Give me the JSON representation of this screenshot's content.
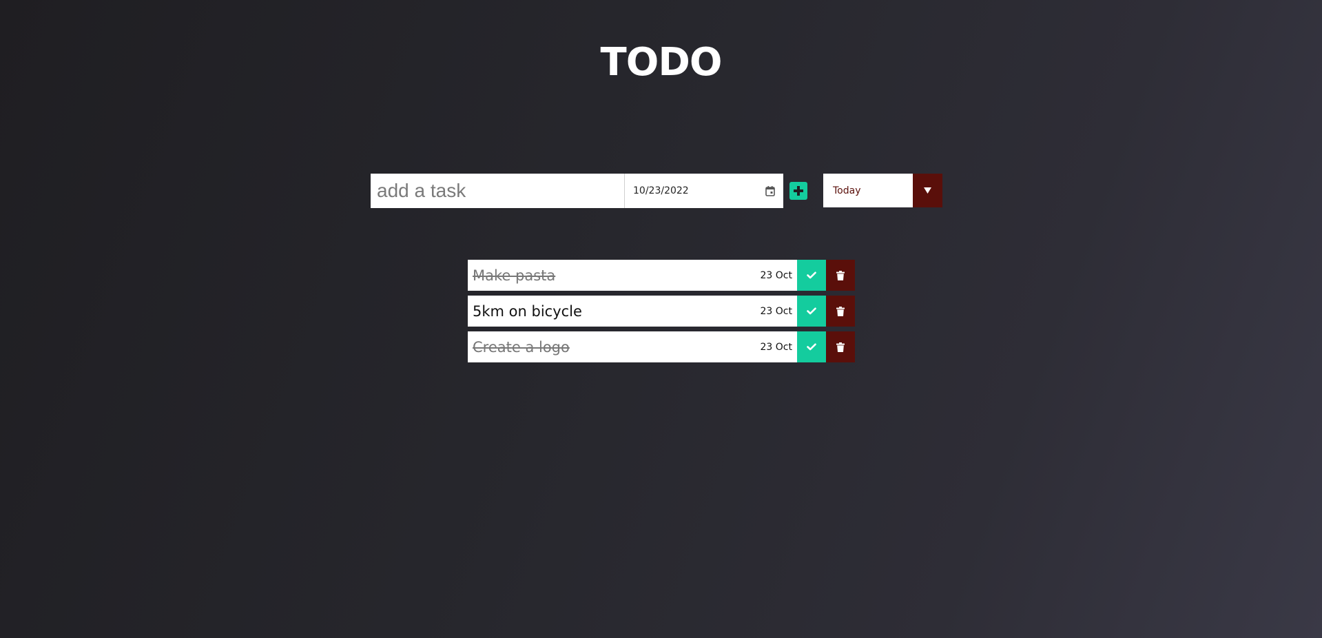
{
  "header": {
    "title": "TODO"
  },
  "form": {
    "task_placeholder": "add a task",
    "date_value": "10/23/2022"
  },
  "filter": {
    "selected": "Today"
  },
  "todos": [
    {
      "text": "Make pasta",
      "date": "23 Oct",
      "completed": true
    },
    {
      "text": "5km on bicycle",
      "date": "23 Oct",
      "completed": false
    },
    {
      "text": "Create a logo",
      "date": "23 Oct",
      "completed": true
    }
  ],
  "colors": {
    "accent": "#14cc9e",
    "danger": "#5a0f0a"
  },
  "icons": {
    "calendar": "calendar-icon",
    "add": "plus-icon",
    "dropdown": "triangle-down-icon",
    "complete": "check-icon",
    "delete": "trash-icon"
  }
}
